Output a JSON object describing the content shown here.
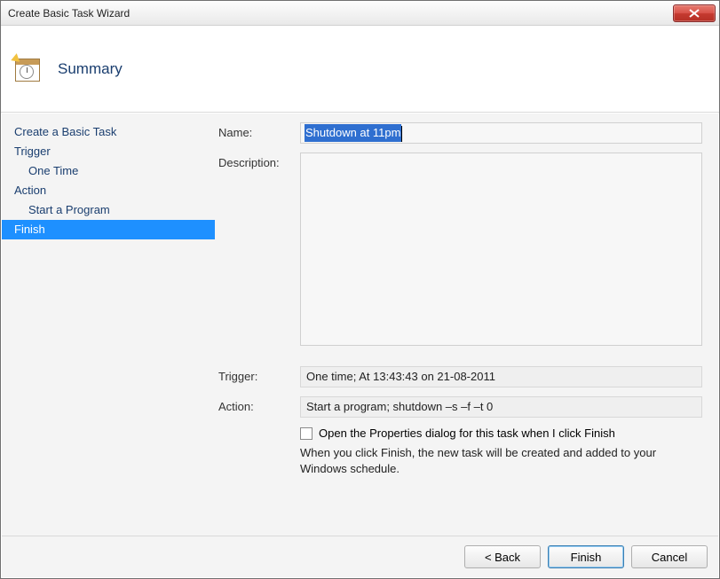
{
  "window": {
    "title": "Create Basic Task Wizard"
  },
  "header": {
    "title": "Summary"
  },
  "sidebar": {
    "items": [
      {
        "label": "Create a Basic Task",
        "indent": false,
        "selected": false
      },
      {
        "label": "Trigger",
        "indent": false,
        "selected": false
      },
      {
        "label": "One Time",
        "indent": true,
        "selected": false
      },
      {
        "label": "Action",
        "indent": false,
        "selected": false
      },
      {
        "label": "Start a Program",
        "indent": true,
        "selected": false
      },
      {
        "label": "Finish",
        "indent": false,
        "selected": true
      }
    ]
  },
  "main": {
    "name_label": "Name:",
    "name_value": "Shutdown at 11pm",
    "description_label": "Description:",
    "description_value": "",
    "trigger_label": "Trigger:",
    "trigger_value": "One time; At 13:43:43 on 21-08-2011",
    "action_label": "Action:",
    "action_value": "Start a program; shutdown –s –f –t 0",
    "open_properties_label": "Open the Properties dialog for this task when I click Finish",
    "open_properties_checked": false,
    "info_text": "When you click Finish, the new task will be created and added to your Windows schedule."
  },
  "footer": {
    "back": "< Back",
    "finish": "Finish",
    "cancel": "Cancel"
  }
}
